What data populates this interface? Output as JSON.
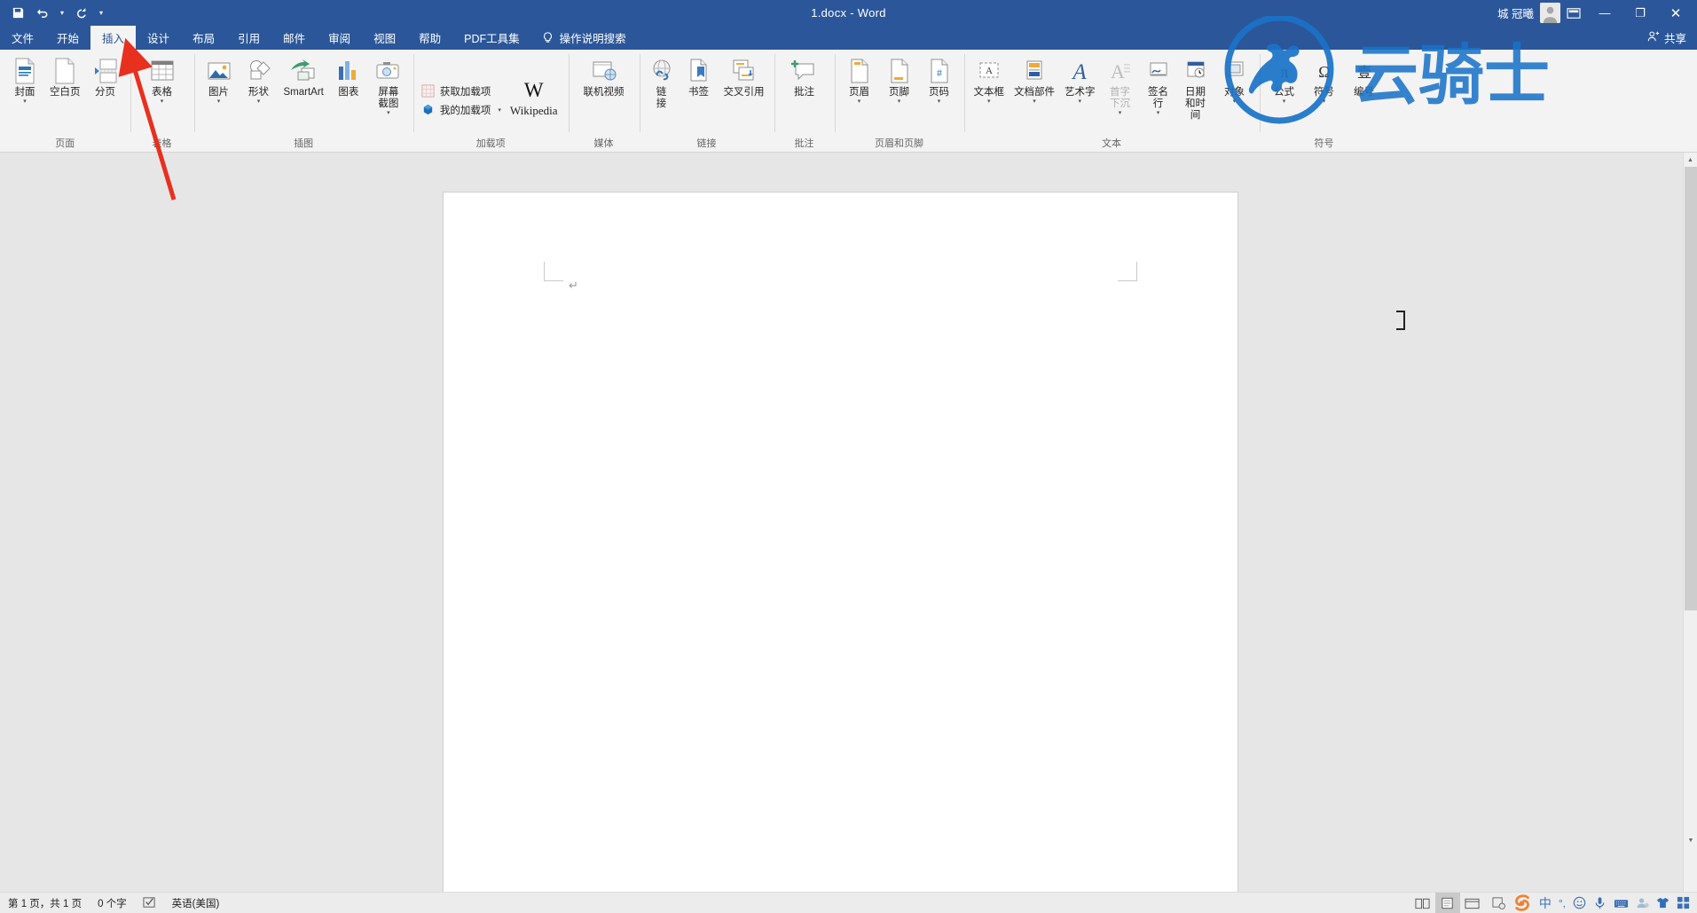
{
  "titlebar": {
    "quick_access": [
      {
        "name": "save",
        "icon": "save-icon"
      },
      {
        "name": "undo",
        "icon": "undo-icon"
      },
      {
        "name": "redo",
        "icon": "redo-icon"
      },
      {
        "name": "customize",
        "icon": "chevron-down-icon"
      }
    ],
    "title": "1.docx  -  Word",
    "username": "城 冠曦",
    "ribbon_display_options": "ribbon-display-options-icon",
    "minimize": "—",
    "restore": "❐",
    "close": "✕"
  },
  "tabs": [
    {
      "label": "文件",
      "active": false
    },
    {
      "label": "开始",
      "active": false
    },
    {
      "label": "插入",
      "active": true
    },
    {
      "label": "设计",
      "active": false
    },
    {
      "label": "布局",
      "active": false
    },
    {
      "label": "引用",
      "active": false
    },
    {
      "label": "邮件",
      "active": false
    },
    {
      "label": "审阅",
      "active": false
    },
    {
      "label": "视图",
      "active": false
    },
    {
      "label": "帮助",
      "active": false
    },
    {
      "label": "PDF工具集",
      "active": false
    }
  ],
  "tellme": {
    "label": "操作说明搜索"
  },
  "share": {
    "label": "共享"
  },
  "ribbon": {
    "groups": [
      {
        "label": "页面",
        "buttons": [
          {
            "label": "封面",
            "icon": "cover-page-icon",
            "caret": true
          },
          {
            "label": "空白页",
            "icon": "blank-page-icon",
            "caret": false
          },
          {
            "label": "分页",
            "icon": "page-break-icon",
            "caret": false
          }
        ]
      },
      {
        "label": "表格",
        "buttons": [
          {
            "label": "表格",
            "icon": "table-icon",
            "caret": true
          }
        ]
      },
      {
        "label": "插图",
        "buttons": [
          {
            "label": "图片",
            "icon": "picture-icon",
            "caret": true
          },
          {
            "label": "形状",
            "icon": "shapes-icon",
            "caret": true
          },
          {
            "label": "SmartArt",
            "icon": "smartart-icon",
            "caret": false
          },
          {
            "label": "图表",
            "icon": "chart-icon",
            "caret": false
          },
          {
            "label": "屏幕截图",
            "icon": "screenshot-icon",
            "caret": true
          }
        ]
      },
      {
        "label": "加载项",
        "small_buttons": [
          {
            "label": "获取加载项",
            "icon": "get-addins-icon"
          },
          {
            "label": "我的加载项",
            "icon": "my-addins-icon",
            "caret": true
          }
        ],
        "wikipedia": {
          "mark": "W",
          "label": "Wikipedia"
        }
      },
      {
        "label": "媒体",
        "buttons": [
          {
            "label": "联机视频",
            "icon": "online-video-icon",
            "caret": false
          }
        ]
      },
      {
        "label": "链接",
        "buttons": [
          {
            "label": "链 接",
            "icon": "link-icon",
            "caret": false
          },
          {
            "label": "书签",
            "icon": "bookmark-icon",
            "caret": false
          },
          {
            "label": "交叉引用",
            "icon": "cross-reference-icon",
            "caret": false
          }
        ]
      },
      {
        "label": "批注",
        "buttons": [
          {
            "label": "批注",
            "icon": "new-comment-icon",
            "caret": false
          }
        ]
      },
      {
        "label": "页眉和页脚",
        "buttons": [
          {
            "label": "页眉",
            "icon": "header-icon",
            "caret": true
          },
          {
            "label": "页脚",
            "icon": "footer-icon",
            "caret": true
          },
          {
            "label": "页码",
            "icon": "page-number-icon",
            "caret": true
          }
        ]
      },
      {
        "label": "文本",
        "buttons": [
          {
            "label": "文本框",
            "icon": "text-box-icon",
            "caret": true
          },
          {
            "label": "文档部件",
            "icon": "quick-parts-icon",
            "caret": true
          },
          {
            "label": "艺术字",
            "icon": "wordart-icon",
            "caret": true
          },
          {
            "label": "首字下沉",
            "icon": "drop-cap-icon",
            "caret": true,
            "disabled": true
          },
          {
            "label": "签名行",
            "icon": "signature-line-icon",
            "caret": true
          },
          {
            "label": "日期和时间",
            "icon": "date-time-icon",
            "caret": false
          },
          {
            "label": "对象",
            "icon": "object-icon",
            "caret": true
          }
        ]
      },
      {
        "label": "符号",
        "buttons": [
          {
            "label": "公式",
            "icon": "equation-icon",
            "caret": true
          },
          {
            "label": "符号",
            "icon": "symbol-icon",
            "caret": true
          },
          {
            "label": "编号",
            "icon": "number-icon",
            "caret": false
          }
        ]
      }
    ]
  },
  "annotation": {
    "type": "red-arrow",
    "points_to": "插入",
    "color": "#e8301e"
  },
  "watermark": {
    "text": "云骑士",
    "color": "#1a73c8"
  },
  "document": {
    "paragraph_mark": "↵",
    "cursor": "i-beam"
  },
  "status": {
    "page_info": "第 1 页，共 1 页",
    "word_count": "0 个字",
    "proofing_icon": "proofing-errors-icon",
    "language": "英语(美国)",
    "views": [
      {
        "name": "read-mode",
        "icon": "read-mode-icon",
        "selected": false
      },
      {
        "name": "print-layout",
        "icon": "print-layout-icon",
        "selected": true
      },
      {
        "name": "web-layout",
        "icon": "web-layout-icon",
        "selected": false
      }
    ],
    "ime": {
      "logo": "sogou-logo-icon",
      "mode": "中",
      "punctuation": "°,",
      "emoji": "emoji-icon",
      "voice": "voice-input-icon",
      "keyboard": "soft-keyboard-icon",
      "user": "user-icon",
      "skin": "skin-icon",
      "tools": "toolbox-icon"
    }
  }
}
